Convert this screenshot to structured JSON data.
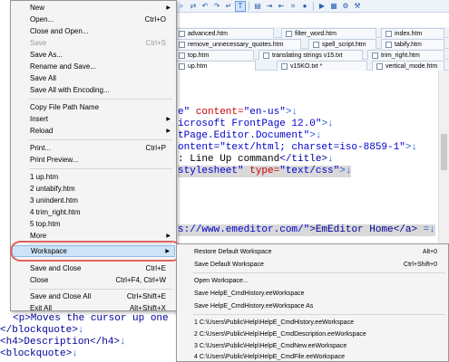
{
  "toolbar": {
    "icons": [
      "search-icon",
      "replace-icon",
      "undo-icon",
      "redo-icon",
      "wrap-icon",
      "text-icon",
      "bookmark-icon",
      "next-icon",
      "prev-icon",
      "macro-icon",
      "record-icon",
      "play-icon",
      "grid-icon",
      "settings-icon",
      "tools-icon"
    ]
  },
  "tabs": {
    "row1": [
      {
        "label": "advanced.htm"
      },
      {
        "label": "filter_word.htm"
      },
      {
        "label": "index.htm"
      }
    ],
    "row2": [
      {
        "label": "remove_unnecessary_quotes.htm"
      },
      {
        "label": "spell_script.htm"
      },
      {
        "label": "tabify.htm"
      }
    ],
    "row3": [
      {
        "label": "top.htm"
      },
      {
        "label": "translating strings v15.txt"
      },
      {
        "label": "trim_right.htm"
      }
    ],
    "row4": [
      {
        "label": "up.htm"
      },
      {
        "label": "v15KO.txt *"
      },
      {
        "label": "vertical_mode.htm"
      }
    ]
  },
  "editor": {
    "lines": [
      {
        "a": "e\"",
        "b": " content=",
        "c": "\"en-us\"",
        "d": ">↓"
      },
      {
        "a": "icrosoft FrontPage 12.0\"",
        "b": ">↓",
        "c": "",
        "d": ""
      },
      {
        "a": "tPage.Editor.Document\"",
        "b": ">↓",
        "c": "",
        "d": ""
      },
      {
        "a": "ontent=\"text/html; charset=iso-8859-1\"",
        "b": ">↓",
        "c": "",
        "d": ""
      },
      {
        "a": ": Line Up command",
        "b": "</title>",
        "c": "↓",
        "d": ""
      },
      {
        "a": "stylesheet\"",
        "b": " type=",
        "c": "\"text/css\"",
        "d": ">↓"
      },
      {
        "a": "s://www.emeditor.com/\"",
        "b": ">EmEditor Home",
        "c": "</a>",
        "d": " =↓"
      },
      {
        "a": "<p>Moves the cursor up one line",
        "b": "",
        "c": "",
        "d": ""
      },
      {
        "a": "</blockquote>",
        "b": "↓",
        "c": "",
        "d": ""
      },
      {
        "a": "<h4>Description</h4>",
        "b": "↓",
        "c": "",
        "d": ""
      },
      {
        "a": "<blockquote>",
        "b": "↓",
        "c": "",
        "d": ""
      }
    ]
  },
  "file_menu": {
    "items": [
      {
        "label": "New",
        "shortcut": "",
        "submenu": true,
        "disabled": false
      },
      {
        "label": "Open...",
        "shortcut": "Ctrl+O",
        "submenu": false,
        "disabled": false
      },
      {
        "label": "Close and Open...",
        "shortcut": "",
        "submenu": false,
        "disabled": false
      },
      {
        "label": "Save",
        "shortcut": "Ctrl+S",
        "submenu": false,
        "disabled": true
      },
      {
        "label": "Save As...",
        "shortcut": "",
        "submenu": false,
        "disabled": false
      },
      {
        "label": "Rename and Save...",
        "shortcut": "",
        "submenu": false,
        "disabled": false
      },
      {
        "label": "Save All",
        "shortcut": "",
        "submenu": false,
        "disabled": false
      },
      {
        "label": "Save All with Encoding...",
        "shortcut": "",
        "submenu": false,
        "disabled": false
      },
      {
        "label": "Copy File Path Name",
        "shortcut": "",
        "submenu": false,
        "disabled": false
      },
      {
        "label": "Insert",
        "shortcut": "",
        "submenu": true,
        "disabled": false
      },
      {
        "label": "Reload",
        "shortcut": "",
        "submenu": true,
        "disabled": false
      },
      {
        "label": "Print...",
        "shortcut": "Ctrl+P",
        "submenu": false,
        "disabled": false
      },
      {
        "label": "Print Preview...",
        "shortcut": "",
        "submenu": false,
        "disabled": false
      },
      {
        "label": "1 up.htm",
        "shortcut": "",
        "submenu": false,
        "disabled": false
      },
      {
        "label": "2 untabify.htm",
        "shortcut": "",
        "submenu": false,
        "disabled": false
      },
      {
        "label": "3 unindent.htm",
        "shortcut": "",
        "submenu": false,
        "disabled": false
      },
      {
        "label": "4 trim_right.htm",
        "shortcut": "",
        "submenu": false,
        "disabled": false
      },
      {
        "label": "5 top.htm",
        "shortcut": "",
        "submenu": false,
        "disabled": false
      },
      {
        "label": "More",
        "shortcut": "",
        "submenu": true,
        "disabled": false
      },
      {
        "label": "Workspace",
        "shortcut": "",
        "submenu": true,
        "disabled": false,
        "selected": true
      },
      {
        "label": "Save and Close",
        "shortcut": "Ctrl+E",
        "submenu": false,
        "disabled": false
      },
      {
        "label": "Close",
        "shortcut": "Ctrl+F4, Ctrl+W",
        "submenu": false,
        "disabled": false
      },
      {
        "label": "Save and Close All",
        "shortcut": "Ctrl+Shift+E",
        "submenu": false,
        "disabled": false
      },
      {
        "label": "Exit All",
        "shortcut": "Alt+Shift+X",
        "submenu": false,
        "disabled": false
      }
    ]
  },
  "workspace_menu": {
    "items": [
      {
        "label": "Restore Default Workspace",
        "shortcut": "Alt+0"
      },
      {
        "label": "Save Default Workspace",
        "shortcut": "Ctrl+Shift+0"
      },
      {
        "label": "Open Workspace...",
        "shortcut": ""
      },
      {
        "label": "Save HelpE_CmdHistory.eeWorkspace",
        "shortcut": ""
      },
      {
        "label": "Save HelpE_CmdHistory.eeWorkspace As",
        "shortcut": ""
      },
      {
        "label": "1 C:\\Users\\Public\\Help\\HelpE_CmdHistory.eeWorkspace",
        "shortcut": ""
      },
      {
        "label": "2 C:\\Users\\Public\\Help\\HelpE_CmdDescription.eeWorkspace",
        "shortcut": ""
      },
      {
        "label": "3 C:\\Users\\Public\\Help\\HelpE_CmdNew.eeWorkspace",
        "shortcut": ""
      },
      {
        "label": "4 C:\\Users\\Public\\Help\\HelpE_CmdFile.eeWorkspace",
        "shortcut": ""
      }
    ]
  },
  "colors": {
    "attr": "#cc0000",
    "value": "#0000cc",
    "tag": "#000099",
    "eol": "#2a64d3",
    "highlight_ring": "#e06060",
    "menu_selected": "#cde3f7"
  }
}
